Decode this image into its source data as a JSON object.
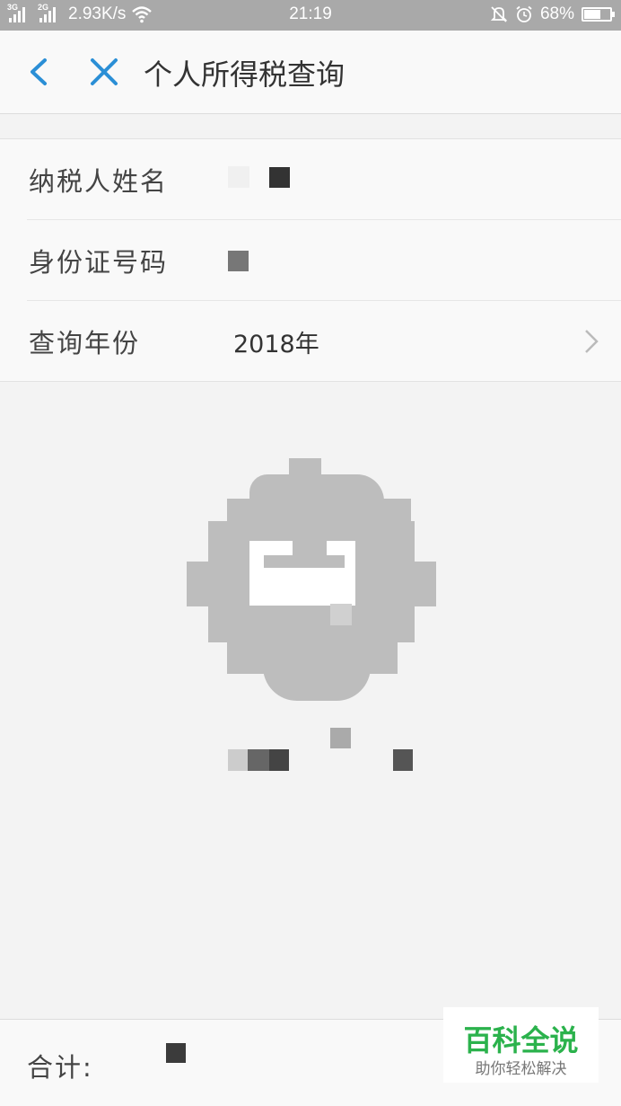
{
  "status_bar": {
    "network1": "3G",
    "network2": "2G",
    "speed": "2.93K/s",
    "time": "21:19",
    "battery": "68%",
    "battery_level": 0.68
  },
  "header": {
    "title": "个人所得税查询"
  },
  "form": {
    "rows": [
      {
        "label": "纳税人姓名",
        "value": ""
      },
      {
        "label": "身份证号码",
        "value": ""
      },
      {
        "label": "查询年份",
        "value": "2018年"
      }
    ]
  },
  "footer": {
    "total_label": "合计:"
  },
  "watermark": {
    "title": "百科全说",
    "subtitle": "助你轻松解决"
  },
  "colors": {
    "accent": "#2b8fd6",
    "watermark_green": "#2bb24c"
  }
}
